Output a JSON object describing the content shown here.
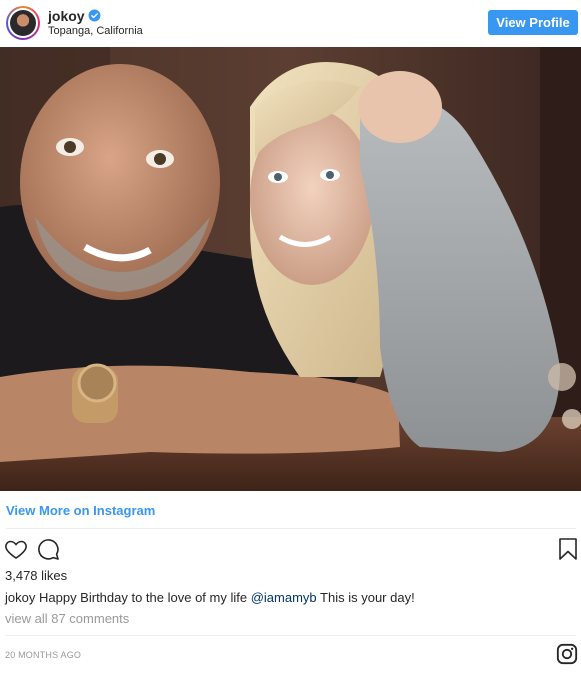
{
  "header": {
    "username": "jokoy",
    "location": "Topanga, California",
    "view_profile_label": "View Profile",
    "verified": true
  },
  "photo": {
    "icon": "photo-image"
  },
  "footer": {
    "view_more_label": "View More on Instagram",
    "likes": "3,478 likes",
    "caption_user": "jokoy",
    "caption_text_before": "Happy Birthday to the love of my life",
    "caption_mention": "@iamamyb",
    "caption_text_after": "This is your day!",
    "comments_link": "view all 87 comments",
    "timestamp": "20 MONTHS AGO"
  },
  "colors": {
    "accent": "#3897f0",
    "mention": "#003569",
    "muted": "#999999"
  }
}
